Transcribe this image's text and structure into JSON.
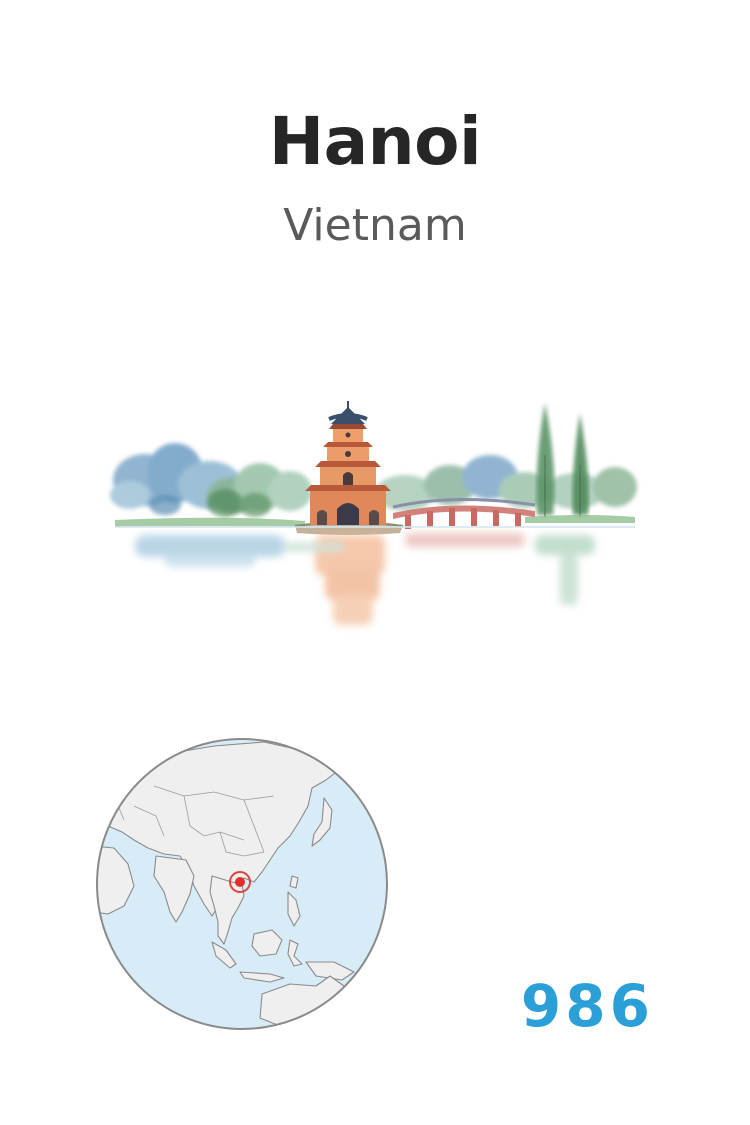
{
  "card": {
    "city": "Hanoi",
    "country": "Vietnam",
    "number": "986"
  },
  "illustration": {
    "subject": "watercolor of turtle tower and red bridge on lake",
    "icon": "landmark-watercolor"
  },
  "globe": {
    "icon": "globe-map-icon",
    "marker_icon": "location-marker-icon"
  },
  "colors": {
    "title": "#262626",
    "subtitle": "#5a5a5a",
    "number": "#2a9fd8",
    "ocean": "#d8ecf8",
    "land": "#efefef",
    "border": "#8a8a8a",
    "marker": "#e0302a"
  }
}
